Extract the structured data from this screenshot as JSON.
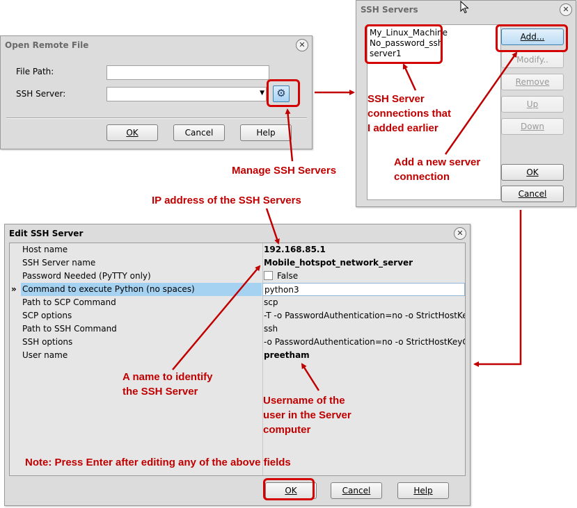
{
  "open_remote_file": {
    "title": "Open Remote File",
    "file_path_label": "File Path:",
    "file_path_value": "",
    "ssh_server_label": "SSH Server:",
    "ssh_server_value": "",
    "ok": "OK",
    "cancel": "Cancel",
    "help": "Help"
  },
  "ssh_servers": {
    "title": "SSH Servers",
    "servers": [
      "My_Linux_Machine",
      "No_password_ssh",
      "server1"
    ],
    "add": "Add...",
    "modify": "Modify..",
    "remove": "Remove",
    "up": "Up",
    "down": "Down",
    "ok": "OK",
    "cancel": "Cancel"
  },
  "edit_ssh_server": {
    "title": "Edit SSH Server",
    "rows": [
      {
        "name": "Host name",
        "value": "192.168.85.1"
      },
      {
        "name": "SSH Server name",
        "value": "Mobile_hotspot_network_server"
      },
      {
        "name": "Password Needed (PyTTY only)",
        "value": "False"
      },
      {
        "name": "Command to execute Python (no spaces)",
        "value": "python3"
      },
      {
        "name": "Path to SCP Command",
        "value": "scp"
      },
      {
        "name": "SCP options",
        "value": "-T -o PasswordAuthentication=no -o StrictHostKeyChe"
      },
      {
        "name": "Path to SSH Command",
        "value": "ssh"
      },
      {
        "name": "SSH options",
        "value": "-o PasswordAuthentication=no -o StrictHostKeyCheck"
      },
      {
        "name": "User name",
        "value": "preetham"
      }
    ],
    "selected_marker": "»",
    "ok": "OK",
    "cancel": "Cancel",
    "help": "Help"
  },
  "annotations": {
    "manage": "Manage SSH Servers",
    "ip": "IP address of the SSH Servers",
    "connections": [
      "SSH Server",
      "connections that",
      "I added earlier"
    ],
    "add_new": [
      "Add a new server",
      "connection"
    ],
    "name_identify": [
      "A name to identify",
      "the SSH Server"
    ],
    "username": [
      "Username of the",
      "user in the Server",
      "computer"
    ],
    "note": "Note: Press Enter after editing any of the above fields"
  },
  "colors": {
    "annotation_red": "#c00000",
    "selection_blue": "#a6d2f1"
  },
  "icons": {
    "close": "close-icon",
    "settings": "gear-icon",
    "dropdown": "dropdown-arrow-icon",
    "cursor": "mouse-cursor-icon"
  }
}
